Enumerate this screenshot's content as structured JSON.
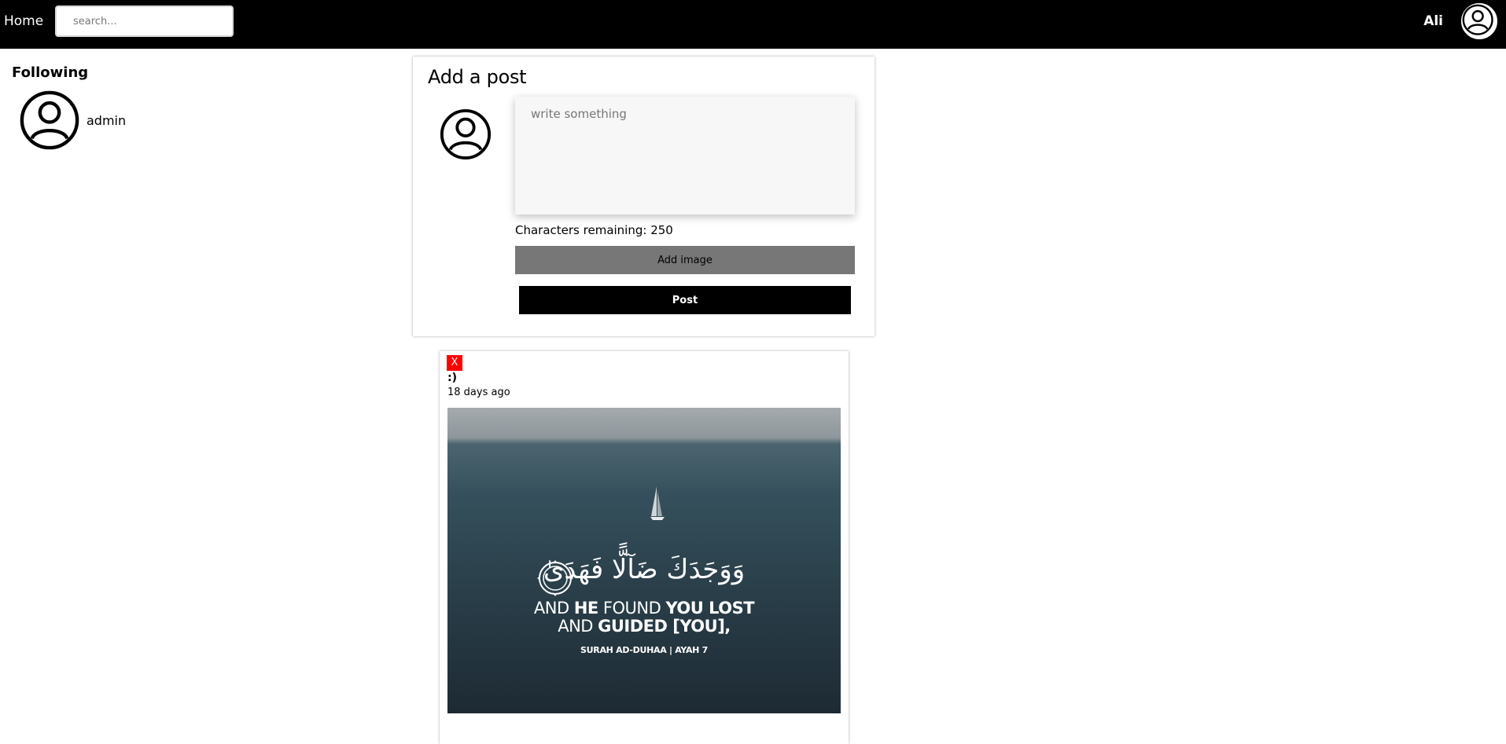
{
  "topbar": {
    "home_label": "Home",
    "search_placeholder": "search...",
    "user_name": "Ali",
    "avatar_icon": "user-circle-icon"
  },
  "sidebar": {
    "title": "Following",
    "items": [
      {
        "name": "admin",
        "icon": "user-circle-icon"
      }
    ]
  },
  "composer": {
    "title": "Add a post",
    "placeholder": "write something",
    "chars_remaining": "Characters remaining: 250",
    "add_image_label": "Add image",
    "post_label": "Post"
  },
  "feed": {
    "posts": [
      {
        "delete_label": "X",
        "text": ":)",
        "time": "18 days ago",
        "image": {
          "arabic": "وَوَجَدَكَ ضَآلًّا فَهَدَىٰ",
          "ayah_number": "٧",
          "line1_a": "AND ",
          "line1_b": "HE",
          "line1_c": " FOUND ",
          "line1_d": "YOU LOST",
          "line2_a": "AND ",
          "line2_b": "GUIDED [YOU],",
          "reference": "SURAH AD-DUHAA | AYAH 7"
        }
      }
    ]
  },
  "colors": {
    "topbar_bg": "#000000",
    "delete_bg": "#ff0000",
    "add_image_bg": "#777777",
    "post_button_bg": "#000000"
  }
}
